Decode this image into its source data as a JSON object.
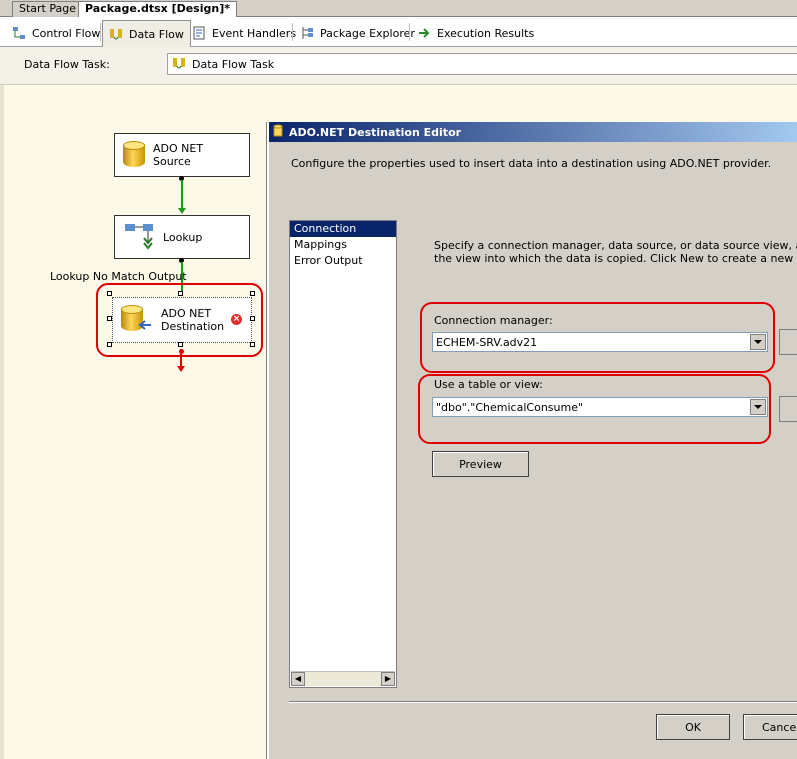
{
  "doc_tabs": [
    "Start Page",
    "Package.dtsx [Design]*"
  ],
  "designer_tabs": [
    {
      "label": "Control Flow",
      "icon": "control-flow-icon"
    },
    {
      "label": "Data Flow",
      "icon": "data-flow-icon"
    },
    {
      "label": "Event Handlers",
      "icon": "event-handlers-icon"
    },
    {
      "label": "Package Explorer",
      "icon": "package-explorer-icon"
    },
    {
      "label": "Execution Results",
      "icon": "execution-results-icon"
    }
  ],
  "task_bar": {
    "label": "Data Flow Task:",
    "value": "Data Flow Task"
  },
  "canvas": {
    "components": [
      {
        "label_line1": "ADO NET",
        "label_line2": "Source"
      },
      {
        "label_line1": "Lookup",
        "label_line2": ""
      },
      {
        "label_line1": "ADO NET",
        "label_line2": "Destination"
      }
    ],
    "path_label": "Lookup No Match Output"
  },
  "dialog": {
    "title": "ADO.NET Destination Editor",
    "description": "Configure the properties used to insert data into a destination using ADO.NET provider.",
    "nav": [
      "Connection Manager",
      "Mappings",
      "Error Output"
    ],
    "info_line1": "Specify a connection manager, data source, or data source view, and selec",
    "info_line2": "the view into which the data is copied. Click New to create a new table or v",
    "connection_label": "Connection manager:",
    "connection_value": "ECHEM-SRV.adv21",
    "table_label": "Use a table or view:",
    "table_value": "\"dbo\".\"ChemicalConsume\"",
    "preview_button": "Preview",
    "ok_button": "OK",
    "cancel_button": "Cancel"
  },
  "colors": {
    "highlight": "#e00000",
    "selection": "#0a246a",
    "canvas": "#fdf9e8",
    "path": "#1a9a1a"
  }
}
